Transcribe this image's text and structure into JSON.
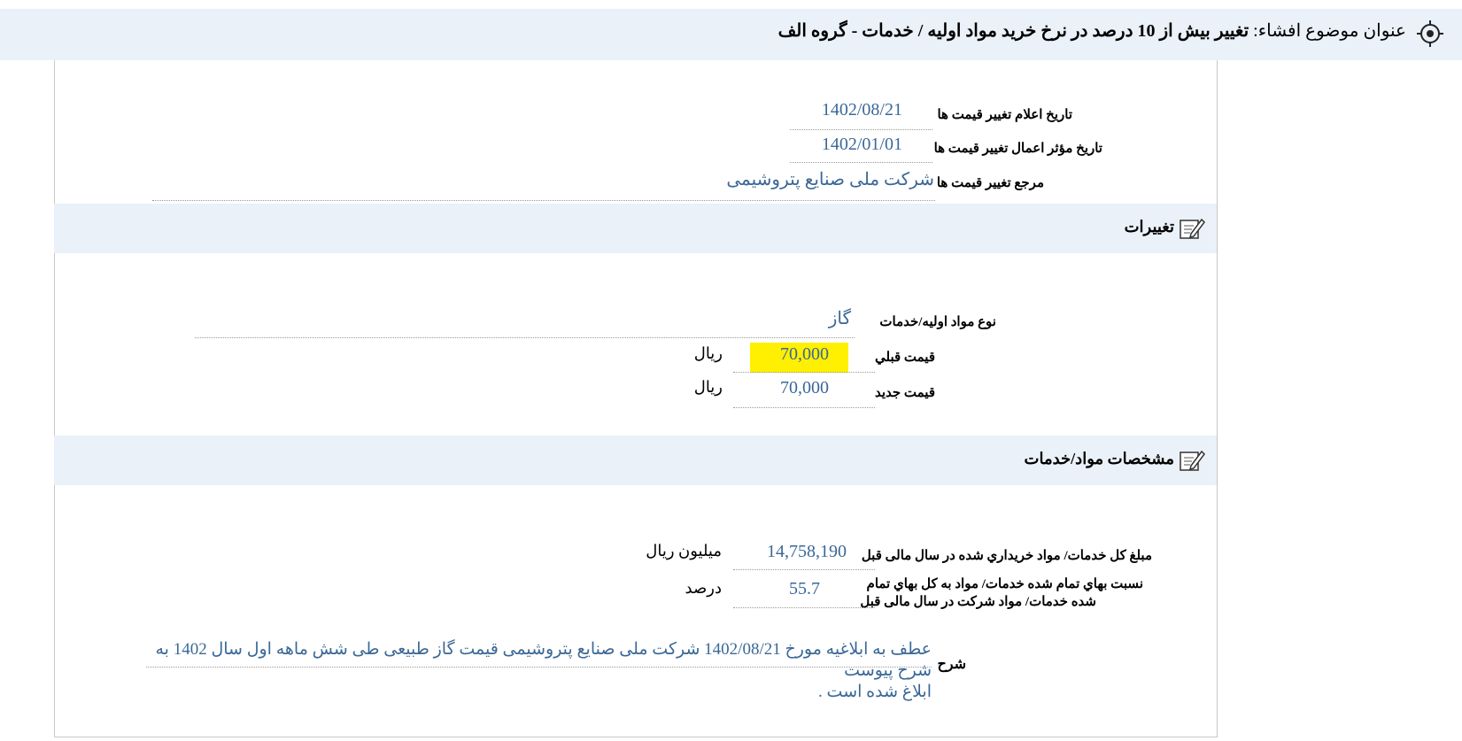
{
  "header": {
    "subject_label": "عنوان موضوع افشاء:",
    "subject_value": "تغییر بیش از 10 درصد در نرخ خرید مواد اولیه / خدمات - گروه الف"
  },
  "info": {
    "announce_date_label": "تاريخ اعلام تغيير قيمت ها",
    "announce_date_value": "1402/08/21",
    "effective_date_label": "تاريخ مؤثر اعمال تغيير قيمت ها",
    "effective_date_value": "1402/01/01",
    "reference_label": "مرجع تغيير قيمت ها",
    "reference_value": "شرکت ملی صنایع پتروشیمی"
  },
  "changes_section": {
    "title": "تغییرات",
    "material_type_label": "نوع مواد اوليه/خدمات",
    "material_type_value": "گاز",
    "old_price_label": "قيمت قبلي",
    "old_price_value": "70,000",
    "old_price_unit": "ريال",
    "new_price_label": "قيمت جديد",
    "new_price_value": "70,000",
    "new_price_unit": "ريال",
    "highlight_color": "#ffef00"
  },
  "specs_section": {
    "title": "مشخصات مواد/خدمات",
    "total_label": "مبلغ کل خدمات/ مواد خريداري شده در سال مالی قبل",
    "total_value": "14,758,190",
    "total_unit": "ميليون ريال",
    "ratio_label_line1": "نسبت بهاي تمام شده خدمات/ مواد به کل بهاي تمام",
    "ratio_label_line2": "شده خدمات/ مواد شرکت در سال مالی قبل",
    "ratio_value": "55.7",
    "ratio_unit": "درصد",
    "description_label": "شرح",
    "description_line1": "عطف به ابلاغیه مورخ 1402/08/21 شرکت ملی صنایع پتروشیمی قیمت گاز طبیعی طی شش ماهه اول سال 1402 به شرح پیوست",
    "description_line2": "ابلاغ شده است ."
  },
  "colors": {
    "band_background": "#eaf1f8",
    "value_blue": "#3a6897"
  }
}
